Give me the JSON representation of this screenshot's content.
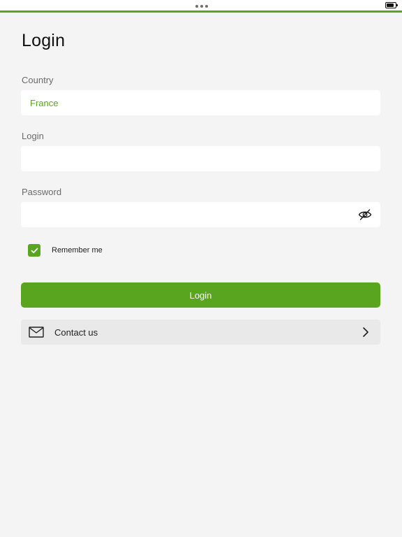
{
  "colors": {
    "accent": "#5aa51f",
    "background": "#f4f4f4",
    "field_background": "#ffffff",
    "secondary_row": "#e9e9e9"
  },
  "page": {
    "title": "Login"
  },
  "form": {
    "country": {
      "label": "Country",
      "value": "France"
    },
    "login": {
      "label": "Login",
      "value": ""
    },
    "password": {
      "label": "Password",
      "value": "",
      "toggle_icon": "eye-slash-icon"
    },
    "remember_me": {
      "label": "Remember me",
      "checked": true
    },
    "submit_label": "Login"
  },
  "contact": {
    "icon": "mail-icon",
    "label": "Contact us",
    "chevron_icon": "chevron-right-icon"
  }
}
